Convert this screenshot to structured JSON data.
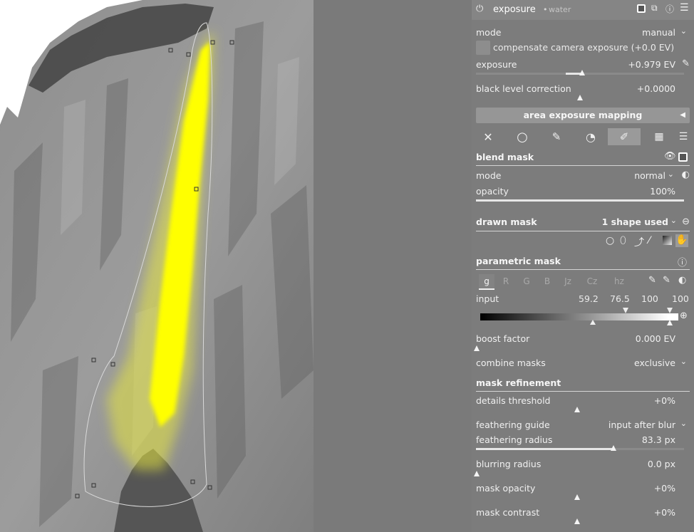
{
  "module": {
    "title": "exposure",
    "instance": "water"
  },
  "basic": {
    "mode_label": "mode",
    "mode_value": "manual",
    "compensate_label": "compensate camera exposure (+0.0 EV)",
    "exposure_label": "exposure",
    "exposure_value": "+0.979 EV",
    "exposure_level": 0.51,
    "black_label": "black level correction",
    "black_value": "+0.0000",
    "black_level": 0.5,
    "area_button": "area exposure mapping"
  },
  "blend_mask": {
    "title": "blend mask",
    "mode_label": "mode",
    "mode_value": "normal",
    "opacity_label": "opacity",
    "opacity_value": "100%",
    "opacity_level": 1.0
  },
  "drawn_mask": {
    "title": "drawn mask",
    "shapes_value": "1 shape used"
  },
  "parametric": {
    "title": "parametric mask",
    "channels": [
      "g",
      "R",
      "G",
      "B",
      "Jz",
      "Cz",
      "hz"
    ],
    "active_channel": "g",
    "input_label": "input",
    "input_values": [
      "59.2",
      "76.5",
      "100",
      "100"
    ],
    "boost_label": "boost factor",
    "boost_value": "0.000 EV",
    "combine_label": "combine masks",
    "combine_value": "exclusive"
  },
  "refinement": {
    "title": "mask refinement",
    "details_label": "details threshold",
    "details_value": "+0%",
    "guide_label": "feathering guide",
    "guide_value": "input after blur",
    "radius_label": "feathering radius",
    "radius_value": "83.3 px",
    "radius_level": 0.66,
    "blur_label": "blurring radius",
    "blur_value": "0.0 px",
    "opacity_label": "mask opacity",
    "opacity_value": "+0%",
    "contrast_label": "mask contrast",
    "contrast_value": "+0%"
  },
  "colors": {
    "mask_overlay": "#ffff00",
    "panel": "#7c7c7c",
    "canvas": "#7a7a7a"
  }
}
